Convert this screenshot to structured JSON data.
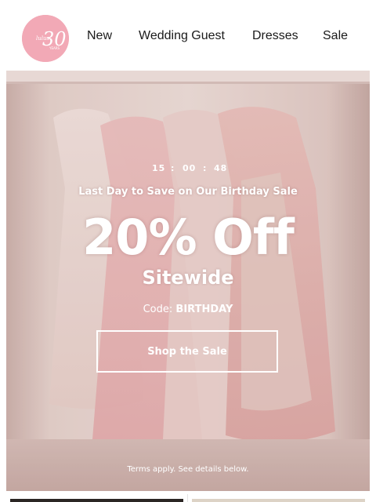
{
  "header": {
    "logo": {
      "brand": "lulus",
      "number": "30",
      "sub": "YEARS",
      "color": "#f2a9b6"
    },
    "nav": [
      {
        "label": "New"
      },
      {
        "label": "Wedding Guest"
      },
      {
        "label": "Dresses"
      },
      {
        "label": "Sale"
      }
    ]
  },
  "hero": {
    "countdown": {
      "hours": "15",
      "minutes": "00",
      "seconds": "48",
      "separator": ":"
    },
    "subhead": "Last Day to Save on Our Birthday Sale",
    "headline": "20% Off",
    "subheadline": "Sitewide",
    "code_label": "Code:",
    "code_value": "BIRTHDAY",
    "cta_label": "Shop the Sale",
    "terms": "Terms apply. See details below.",
    "accent": "#ffffff",
    "background": "#e8d5d0"
  }
}
